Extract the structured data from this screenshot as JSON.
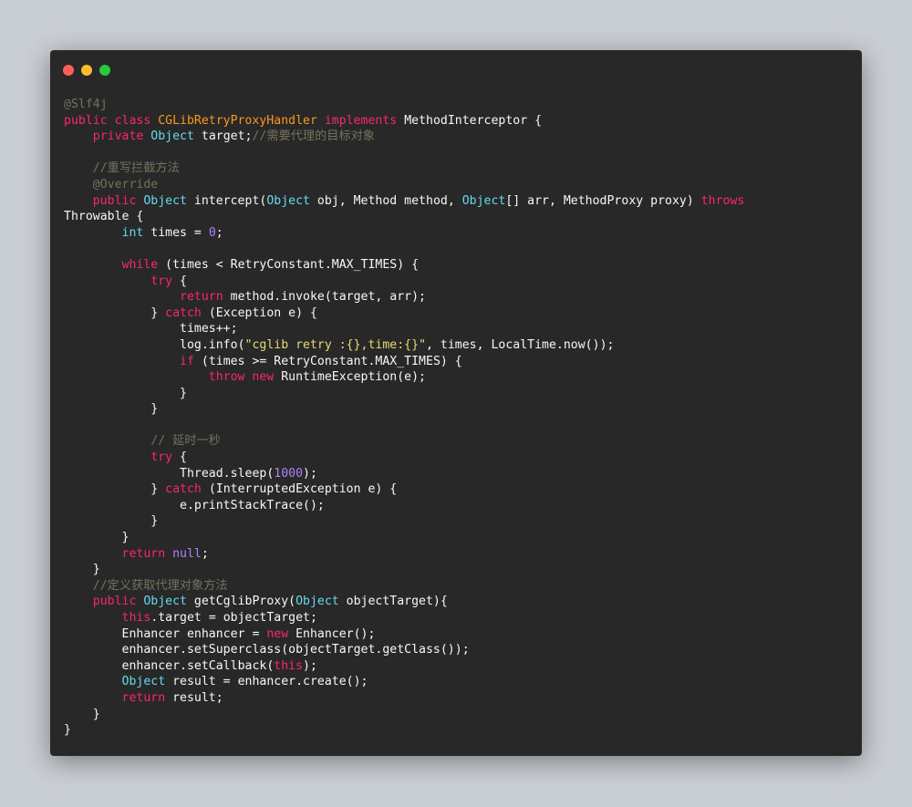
{
  "window": {
    "dots": [
      {
        "name": "close-dot",
        "color": "#ff5f56"
      },
      {
        "name": "minimize-dot",
        "color": "#ffbd2e"
      },
      {
        "name": "maximize-dot",
        "color": "#27c93f"
      }
    ]
  },
  "palette": {
    "kw": "#f92672",
    "type": "#66d9ef",
    "id": "#f8f8f2",
    "cls": "#fd971f",
    "str": "#e6db74",
    "num": "#ae81ff",
    "com": "#75715e",
    "ann": "#75715e",
    "plain": "#f8f8f2"
  },
  "code": {
    "lines": [
      [
        [
          "ann",
          "@Slf4j"
        ]
      ],
      [
        [
          "kw",
          "public class "
        ],
        [
          "cls",
          "CGLibRetryProxyHandler "
        ],
        [
          "kw",
          "implements "
        ],
        [
          "id",
          "MethodInterceptor {"
        ]
      ],
      [
        [
          "plain",
          "    "
        ],
        [
          "kw",
          "private "
        ],
        [
          "type",
          "Object "
        ],
        [
          "id",
          "target;"
        ],
        [
          "com",
          "//需要代理的目标对象"
        ]
      ],
      [],
      [
        [
          "plain",
          "    "
        ],
        [
          "com",
          "//重写拦截方法"
        ]
      ],
      [
        [
          "plain",
          "    "
        ],
        [
          "ann",
          "@Override"
        ]
      ],
      [
        [
          "plain",
          "    "
        ],
        [
          "kw",
          "public "
        ],
        [
          "type",
          "Object "
        ],
        [
          "id",
          "intercept("
        ],
        [
          "type",
          "Object "
        ],
        [
          "id",
          "obj, Method method, "
        ],
        [
          "type",
          "Object"
        ],
        [
          "id",
          "[] arr, MethodProxy proxy) "
        ],
        [
          "kw",
          "throws"
        ]
      ],
      [
        [
          "id",
          "Throwable {"
        ]
      ],
      [
        [
          "plain",
          "        "
        ],
        [
          "type",
          "int "
        ],
        [
          "id",
          "times = "
        ],
        [
          "num",
          "0"
        ],
        [
          "id",
          ";"
        ]
      ],
      [],
      [
        [
          "plain",
          "        "
        ],
        [
          "kw",
          "while "
        ],
        [
          "id",
          "(times < RetryConstant.MAX_TIMES) {"
        ]
      ],
      [
        [
          "plain",
          "            "
        ],
        [
          "kw",
          "try "
        ],
        [
          "id",
          "{"
        ]
      ],
      [
        [
          "plain",
          "                "
        ],
        [
          "kw",
          "return "
        ],
        [
          "id",
          "method.invoke(target, arr);"
        ]
      ],
      [
        [
          "plain",
          "            "
        ],
        [
          "id",
          "} "
        ],
        [
          "kw",
          "catch "
        ],
        [
          "id",
          "(Exception e) {"
        ]
      ],
      [
        [
          "plain",
          "                "
        ],
        [
          "id",
          "times++;"
        ]
      ],
      [
        [
          "plain",
          "                "
        ],
        [
          "id",
          "log.info("
        ],
        [
          "str",
          "\"cglib retry :{},time:{}\""
        ],
        [
          "id",
          ", times, LocalTime.now());"
        ]
      ],
      [
        [
          "plain",
          "                "
        ],
        [
          "kw",
          "if "
        ],
        [
          "id",
          "(times >= RetryConstant.MAX_TIMES) {"
        ]
      ],
      [
        [
          "plain",
          "                    "
        ],
        [
          "kw",
          "throw new "
        ],
        [
          "id",
          "RuntimeException(e);"
        ]
      ],
      [
        [
          "plain",
          "                "
        ],
        [
          "id",
          "}"
        ]
      ],
      [
        [
          "plain",
          "            "
        ],
        [
          "id",
          "}"
        ]
      ],
      [],
      [
        [
          "plain",
          "            "
        ],
        [
          "com",
          "// 延时一秒"
        ]
      ],
      [
        [
          "plain",
          "            "
        ],
        [
          "kw",
          "try "
        ],
        [
          "id",
          "{"
        ]
      ],
      [
        [
          "plain",
          "                "
        ],
        [
          "id",
          "Thread.sleep("
        ],
        [
          "num",
          "1000"
        ],
        [
          "id",
          ");"
        ]
      ],
      [
        [
          "plain",
          "            "
        ],
        [
          "id",
          "} "
        ],
        [
          "kw",
          "catch "
        ],
        [
          "id",
          "(InterruptedException e) {"
        ]
      ],
      [
        [
          "plain",
          "                "
        ],
        [
          "id",
          "e.printStackTrace();"
        ]
      ],
      [
        [
          "plain",
          "            "
        ],
        [
          "id",
          "}"
        ]
      ],
      [
        [
          "plain",
          "        "
        ],
        [
          "id",
          "}"
        ]
      ],
      [
        [
          "plain",
          "        "
        ],
        [
          "kw",
          "return "
        ],
        [
          "num",
          "null"
        ],
        [
          "id",
          ";"
        ]
      ],
      [
        [
          "plain",
          "    "
        ],
        [
          "id",
          "}"
        ]
      ],
      [
        [
          "plain",
          "    "
        ],
        [
          "com",
          "//定义获取代理对象方法"
        ]
      ],
      [
        [
          "plain",
          "    "
        ],
        [
          "kw",
          "public "
        ],
        [
          "type",
          "Object "
        ],
        [
          "id",
          "getCglibProxy("
        ],
        [
          "type",
          "Object "
        ],
        [
          "id",
          "objectTarget){"
        ]
      ],
      [
        [
          "plain",
          "        "
        ],
        [
          "kw",
          "this"
        ],
        [
          "id",
          ".target = objectTarget;"
        ]
      ],
      [
        [
          "plain",
          "        "
        ],
        [
          "id",
          "Enhancer enhancer = "
        ],
        [
          "kw",
          "new "
        ],
        [
          "id",
          "Enhancer();"
        ]
      ],
      [
        [
          "plain",
          "        "
        ],
        [
          "id",
          "enhancer.setSuperclass(objectTarget.getClass());"
        ]
      ],
      [
        [
          "plain",
          "        "
        ],
        [
          "id",
          "enhancer.setCallback("
        ],
        [
          "kw",
          "this"
        ],
        [
          "id",
          ");"
        ]
      ],
      [
        [
          "plain",
          "        "
        ],
        [
          "type",
          "Object "
        ],
        [
          "id",
          "result = enhancer.create();"
        ]
      ],
      [
        [
          "plain",
          "        "
        ],
        [
          "kw",
          "return "
        ],
        [
          "id",
          "result;"
        ]
      ],
      [
        [
          "plain",
          "    "
        ],
        [
          "id",
          "}"
        ]
      ],
      [
        [
          "id",
          "}"
        ]
      ]
    ]
  }
}
